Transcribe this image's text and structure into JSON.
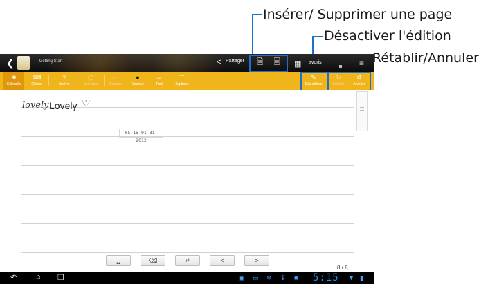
{
  "callouts": {
    "insert_delete_page": "Insérer/ Supprimer une page",
    "disable_editing": "Désactiver l'édition",
    "redo_undo": "Rétablir/Annuler"
  },
  "appbar": {
    "notebook_title": "-- Getting Start",
    "share_label": "Partager",
    "favorites_label": "avoris"
  },
  "toolbar": {
    "items": [
      {
        "label": "Gribouille",
        "icon": "scribble-icon"
      },
      {
        "label": "Clavier",
        "icon": "keyboard-icon"
      },
      {
        "label": "Insérer",
        "icon": "insert-icon"
      },
      {
        "label": "Sélection",
        "icon": "selection-icon"
      },
      {
        "label": "Gomme",
        "icon": "eraser-icon"
      },
      {
        "label": "Couleur",
        "icon": "color-icon"
      },
      {
        "label": "Trait",
        "icon": "stroke-icon"
      },
      {
        "label": "Lig.base",
        "icon": "baseline-icon"
      },
      {
        "label": "Dés.édition",
        "icon": "disable-edit-icon"
      },
      {
        "label": "Rétablir",
        "icon": "redo-icon"
      },
      {
        "label": "Annuler",
        "icon": "undo-icon"
      }
    ]
  },
  "page": {
    "handwriting": "lovely",
    "typed_text": "Lovely",
    "timestamp": "05:15 01-31-2012",
    "page_indicator": "8  /  8"
  },
  "system": {
    "clock": "5:15"
  }
}
